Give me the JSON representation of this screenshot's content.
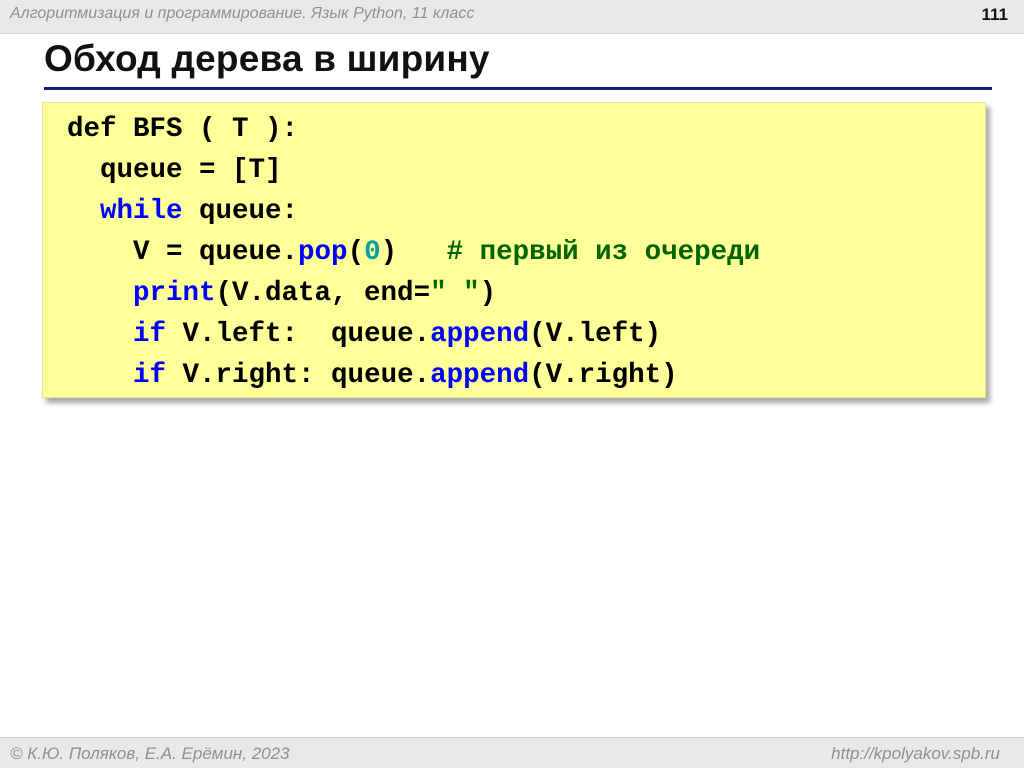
{
  "header": {
    "course_title": "Алгоритмизация и программирование. Язык Python, 11 класс",
    "slide_number": "111"
  },
  "slide": {
    "title": "Обход дерева в ширину"
  },
  "code": {
    "lines": [
      [
        {
          "t": "def BFS ( T ):",
          "c": "plain"
        }
      ],
      [
        {
          "t": "  queue = [T]",
          "c": "plain"
        }
      ],
      [
        {
          "t": "  ",
          "c": "plain"
        },
        {
          "t": "while",
          "c": "kw"
        },
        {
          "t": " queue:",
          "c": "plain"
        }
      ],
      [
        {
          "t": "    V = queue.",
          "c": "plain"
        },
        {
          "t": "pop",
          "c": "fn"
        },
        {
          "t": "(",
          "c": "plain"
        },
        {
          "t": "0",
          "c": "num"
        },
        {
          "t": ")   ",
          "c": "plain"
        },
        {
          "t": "# первый из очереди",
          "c": "cmt"
        }
      ],
      [
        {
          "t": "    ",
          "c": "plain"
        },
        {
          "t": "print",
          "c": "fn"
        },
        {
          "t": "(V.data, end=",
          "c": "plain"
        },
        {
          "t": "\" \"",
          "c": "str"
        },
        {
          "t": ")",
          "c": "plain"
        }
      ],
      [
        {
          "t": "    ",
          "c": "plain"
        },
        {
          "t": "if",
          "c": "kw"
        },
        {
          "t": " V.left:  queue.",
          "c": "plain"
        },
        {
          "t": "append",
          "c": "fn"
        },
        {
          "t": "(V.left)",
          "c": "plain"
        }
      ],
      [
        {
          "t": "    ",
          "c": "plain"
        },
        {
          "t": "if",
          "c": "kw"
        },
        {
          "t": " V.right: queue.",
          "c": "plain"
        },
        {
          "t": "append",
          "c": "fn"
        },
        {
          "t": "(V.right)",
          "c": "plain"
        }
      ]
    ]
  },
  "footer": {
    "authors": "© К.Ю. Поляков, Е.А. Ерёмин, 2023",
    "url": "http://kpolyakov.spb.ru"
  }
}
